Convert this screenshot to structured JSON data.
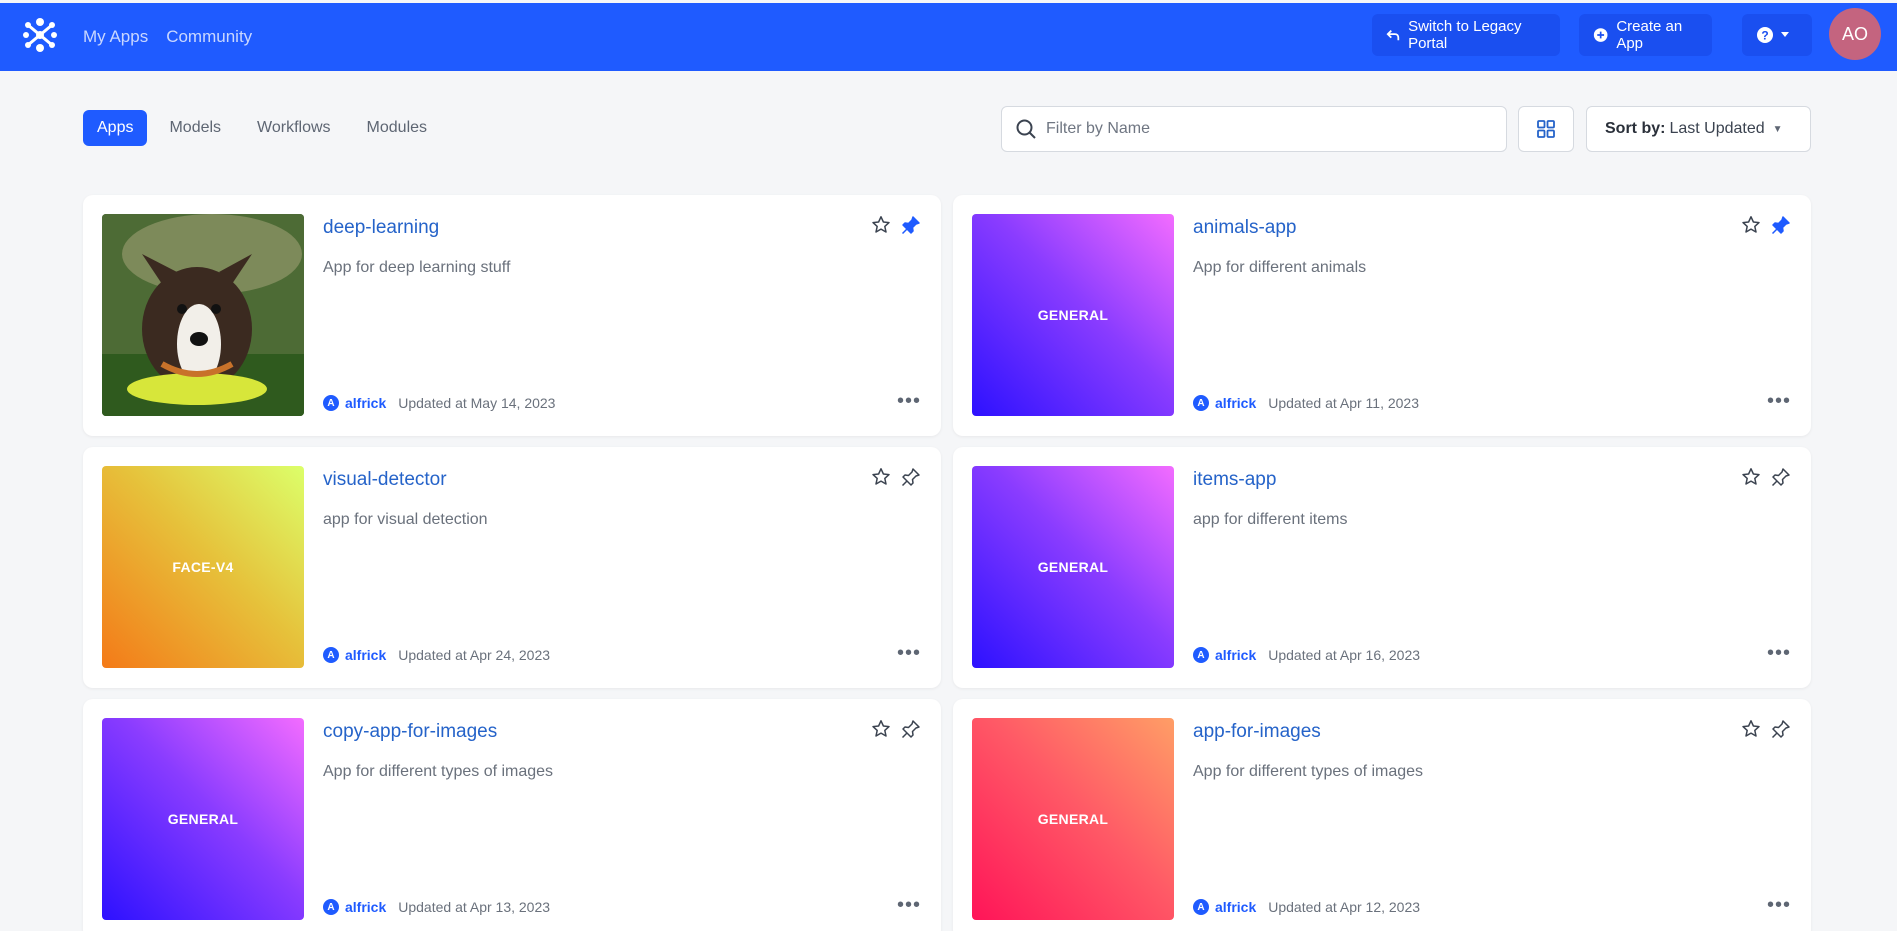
{
  "header": {
    "nav": [
      "My Apps",
      "Community"
    ],
    "legacy_label": "Switch to Legacy Portal",
    "create_label": "Create an App",
    "help_icon": "question-circle-icon",
    "avatar_initials": "AO"
  },
  "toolbar": {
    "tabs": [
      "Apps",
      "Models",
      "Workflows",
      "Modules"
    ],
    "active_tab": "Apps",
    "search_placeholder": "Filter by Name",
    "sort_prefix": "Sort by:",
    "sort_value": "Last Updated"
  },
  "colors": {
    "brand": "#1f5bff",
    "link": "#2563c9",
    "avatar": "#c4647f"
  },
  "apps": [
    {
      "title": "deep-learning",
      "description": "App for deep learning stuff",
      "thumb_label": "",
      "thumb_kind": "dog-photo",
      "user": "alfrick",
      "user_initial": "A",
      "updated": "Updated at May 14, 2023",
      "pinned": true
    },
    {
      "title": "animals-app",
      "description": "App for different animals",
      "thumb_label": "GENERAL",
      "thumb_kind": "gradient-violet",
      "user": "alfrick",
      "user_initial": "A",
      "updated": "Updated at Apr 11, 2023",
      "pinned": true
    },
    {
      "title": "visual-detector",
      "description": "app for visual detection",
      "thumb_label": "FACE-V4",
      "thumb_kind": "gradient-yellow",
      "user": "alfrick",
      "user_initial": "A",
      "updated": "Updated at Apr 24, 2023",
      "pinned": false
    },
    {
      "title": "items-app",
      "description": "app for different items",
      "thumb_label": "GENERAL",
      "thumb_kind": "gradient-violet",
      "user": "alfrick",
      "user_initial": "A",
      "updated": "Updated at Apr 16, 2023",
      "pinned": false
    },
    {
      "title": "copy-app-for-images",
      "description": "App for different types of images",
      "thumb_label": "GENERAL",
      "thumb_kind": "gradient-violet",
      "user": "alfrick",
      "user_initial": "A",
      "updated": "Updated at Apr 13, 2023",
      "pinned": false
    },
    {
      "title": "app-for-images",
      "description": "App for different types of images",
      "thumb_label": "GENERAL",
      "thumb_kind": "gradient-pink",
      "user": "alfrick",
      "user_initial": "A",
      "updated": "Updated at Apr 12, 2023",
      "pinned": false
    }
  ]
}
